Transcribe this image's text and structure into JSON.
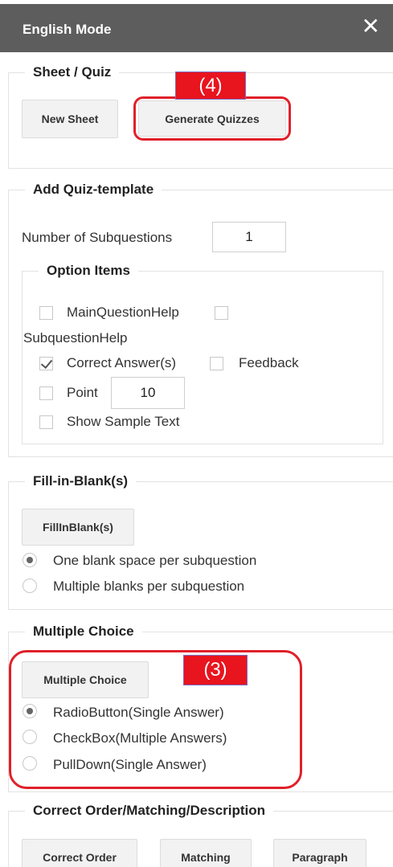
{
  "header": {
    "title": "English Mode",
    "close_glyph": "✕"
  },
  "sheet_quiz": {
    "legend": "Sheet / Quiz",
    "new_sheet_label": "New Sheet",
    "generate_label": "Generate Quizzes",
    "annotation": "(4)"
  },
  "quiz_template": {
    "legend": "Add Quiz-template",
    "subq_label": "Number of Subquestions",
    "subq_value": "1",
    "options": {
      "legend": "Option Items",
      "main_help": "MainQuestionHelp",
      "sub_help": "SubquestionHelp",
      "correct": "Correct Answer(s)",
      "feedback": "Feedback",
      "point": "Point",
      "point_value": "10",
      "sample": "Show Sample Text"
    }
  },
  "fill_blank": {
    "legend": "Fill-in-Blank(s)",
    "button": "FillInBlank(s)",
    "opt1": "One blank space per subquestion",
    "opt2": "Multiple blanks per subquestion"
  },
  "multiple_choice": {
    "legend": "Multiple Choice",
    "button": "Multiple Choice",
    "annotation": "(3)",
    "opt1": "RadioButton(Single Answer)",
    "opt2": "CheckBox(Multiple Answers)",
    "opt3": "PullDown(Single Answer)"
  },
  "order_section": {
    "legend": "Correct Order/Matching/Description",
    "correct_order": "Correct Order",
    "matching": "Matching",
    "paragraph": "Paragraph"
  },
  "colors": {
    "header_bg": "#5d5d5d",
    "annotation_red": "#e0202a"
  }
}
